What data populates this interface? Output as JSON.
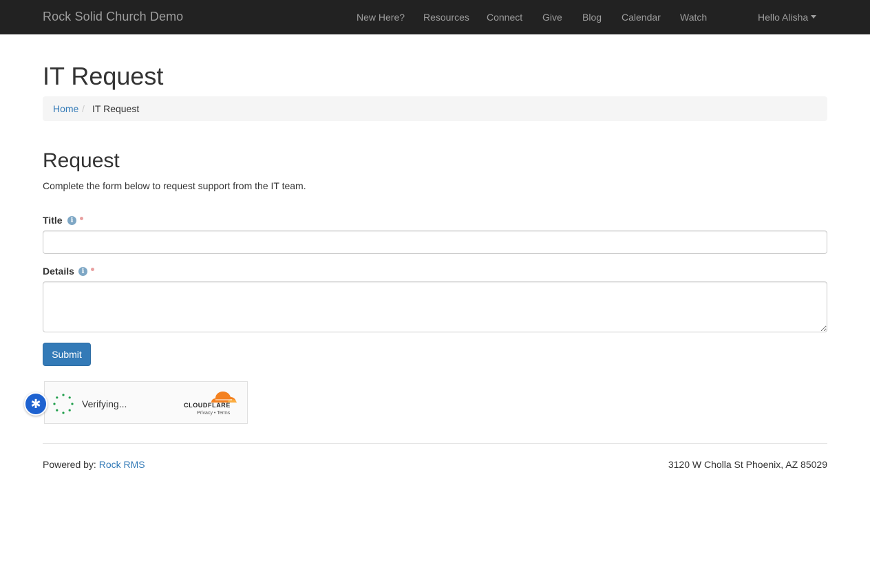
{
  "navbar": {
    "brand": "Rock Solid Church Demo",
    "items": [
      "New Here?",
      "Resources",
      "Connect",
      "Give",
      "Blog",
      "Calendar",
      "Watch"
    ],
    "user_menu": "Hello Alisha"
  },
  "page": {
    "title": "IT Request",
    "breadcrumb": {
      "home": "Home",
      "current": "IT Request"
    }
  },
  "form": {
    "heading": "Request",
    "description": "Complete the form below to request support from the IT team.",
    "fields": [
      {
        "label": "Title",
        "value": "",
        "required": true
      },
      {
        "label": "Details",
        "value": "",
        "required": true
      }
    ],
    "submit_label": "Submit"
  },
  "captcha": {
    "status": "Verifying...",
    "brand": "CLOUDFLARE",
    "privacy_link": "Privacy",
    "separator": "•",
    "terms_link": "Terms"
  },
  "footer": {
    "powered_by": "Powered by:",
    "powered_link": "Rock RMS",
    "address": "3120 W Cholla St Phoenix, AZ 85029"
  },
  "colors": {
    "navbar_bg": "#222222",
    "nav_text": "#9d9d9d",
    "link": "#337ab7",
    "primary_button": "#337ab7",
    "required_dot": "#e9a0a0",
    "info_icon": "#7ea7c5",
    "cloudflare_orange": "#f48120"
  },
  "icons": {
    "info": "info-circle-icon",
    "user_caret": "caret-down-icon",
    "float_button": "asterisk-icon",
    "spinner": "loading-spinner-icon"
  }
}
